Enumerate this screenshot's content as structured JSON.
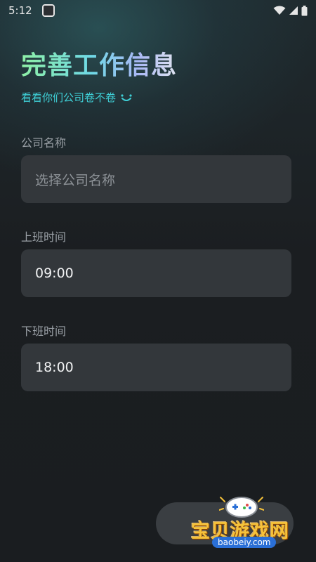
{
  "status_bar": {
    "time": "5:12"
  },
  "header": {
    "title": "完善工作信息",
    "subtitle": "看看你们公司卷不卷"
  },
  "form": {
    "company": {
      "label": "公司名称",
      "placeholder": "选择公司名称"
    },
    "start_time": {
      "label": "上班时间",
      "value": "09:00"
    },
    "end_time": {
      "label": "下班时间",
      "value": "18:00"
    }
  },
  "footer": {
    "next_label": ""
  },
  "watermark": {
    "text": "宝贝游戏网",
    "url": "baobeiy.com"
  },
  "colors": {
    "accent": "#3fcfd6",
    "background": "#1b1e21",
    "field_background": "#33373b",
    "watermark_gold": "#f6c23a"
  }
}
